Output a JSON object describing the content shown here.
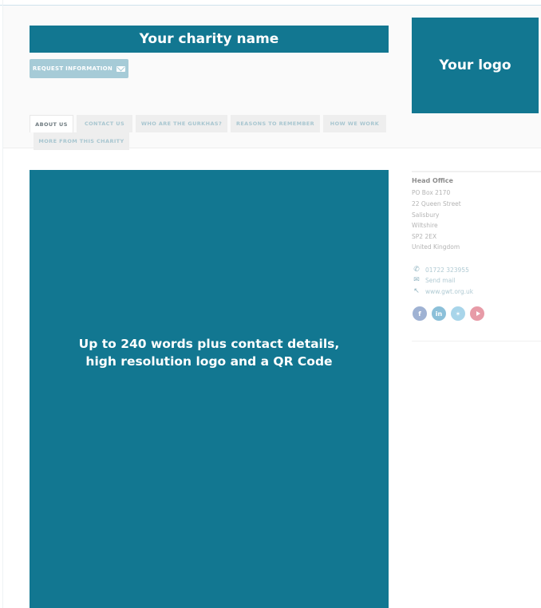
{
  "header": {
    "charity_name": "Your charity name",
    "logo_text": "Your logo",
    "request_button": "REQUEST INFORMATION"
  },
  "tabs": [
    {
      "label": "ABOUT US",
      "active": true
    },
    {
      "label": "CONTACT US",
      "active": false
    },
    {
      "label": "WHO ARE THE GURKHAS?",
      "active": false
    },
    {
      "label": "REASONS TO REMEMBER",
      "active": false
    },
    {
      "label": "HOW WE WORK",
      "active": false
    },
    {
      "label": "MORE FROM THIS CHARITY",
      "active": false
    }
  ],
  "content": {
    "line1": "Up to 240 words plus contact details,",
    "line2": "high resolution logo and a QR Code"
  },
  "sidebar": {
    "office_title": "Head Office",
    "address": [
      "PO Box 2170",
      "22 Queen Street",
      "Salisbury",
      "Wiltshire",
      "SP2 2EX",
      "United Kingdom"
    ],
    "phone": "01722 323955",
    "email_label": "Send mail",
    "website": "www.gwt.org.uk",
    "social_icons": [
      "facebook-icon",
      "linkedin-icon",
      "twitter-icon",
      "youtube-icon"
    ]
  },
  "colors": {
    "brand": "#127791",
    "button": "#a6cbd7"
  }
}
